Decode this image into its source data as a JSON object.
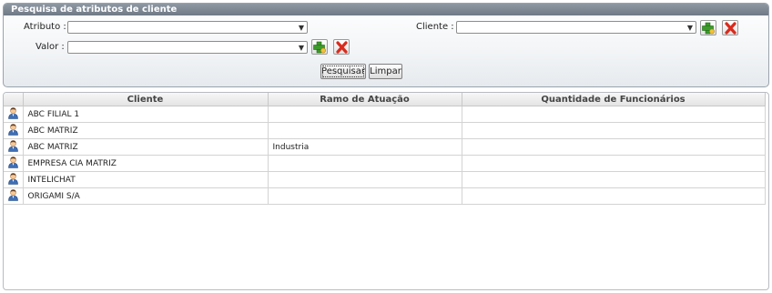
{
  "search_panel": {
    "title": "Pesquisa de atributos de cliente",
    "atributo_label": "Atributo :",
    "atributo_value": "",
    "cliente_label": "Cliente :",
    "cliente_value": "",
    "valor_label": "Valor :",
    "valor_value": "",
    "pesquisar_label": "Pesquisar",
    "limpar_label": "Limpar",
    "icons": {
      "add": "add-icon",
      "remove": "remove-icon",
      "dropdown": "chevron-down-icon"
    }
  },
  "results": {
    "columns": [
      "Cliente",
      "Ramo de Atuação",
      "Quantidade de Funcionários"
    ],
    "rows": [
      {
        "cliente": "ABC FILIAL 1",
        "ramo": "",
        "quantidade": ""
      },
      {
        "cliente": "ABC MATRIZ",
        "ramo": "",
        "quantidade": ""
      },
      {
        "cliente": "ABC MATRIZ",
        "ramo": "Industria",
        "quantidade": ""
      },
      {
        "cliente": "EMPRESA CIA MATRIZ",
        "ramo": "",
        "quantidade": ""
      },
      {
        "cliente": "INTELICHAT",
        "ramo": "",
        "quantidade": ""
      },
      {
        "cliente": "ORIGAMI S/A",
        "ramo": "",
        "quantidade": ""
      }
    ],
    "row_icon": "user-icon"
  },
  "colors": {
    "header_bar": "#7c8792",
    "panel_border": "#9aa3ad",
    "grid_border": "#b7bcc2"
  }
}
